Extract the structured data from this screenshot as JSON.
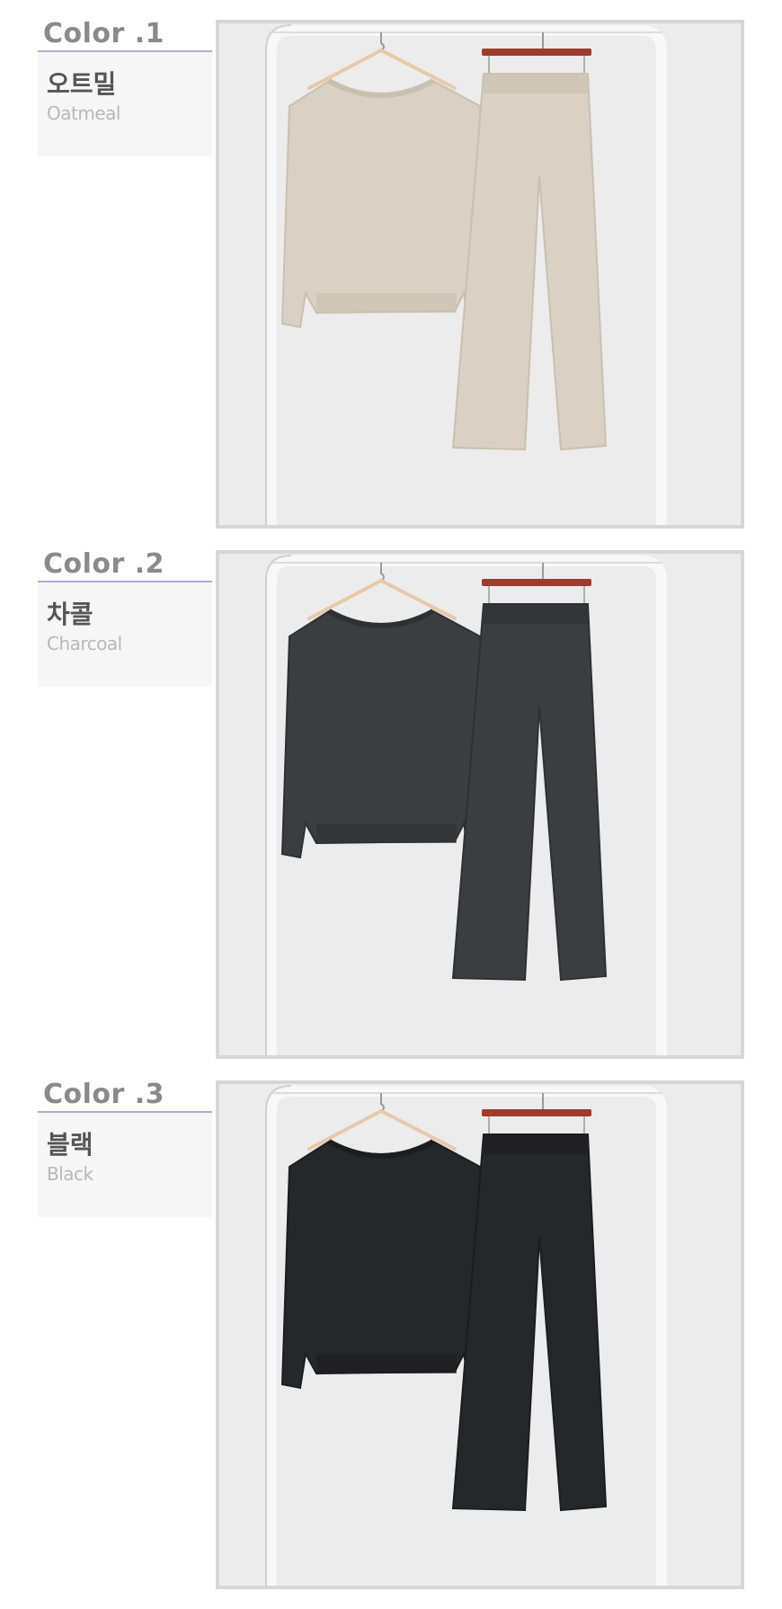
{
  "colors": [
    {
      "heading": "Color .1",
      "name_ko": "오트밀",
      "name_en": "Oatmeal",
      "garment_color": "#d9d1c3",
      "garment_shade": "#c9c0b0"
    },
    {
      "heading": "Color .2",
      "name_ko": "차콜",
      "name_en": "Charcoal",
      "garment_color": "#3c3d41",
      "garment_shade": "#2f3034"
    },
    {
      "heading": "Color .3",
      "name_ko": "블랙",
      "name_en": "Black",
      "garment_color": "#26272b",
      "garment_shade": "#1c1d20"
    }
  ],
  "accent": {
    "underline": "#b5a9da",
    "label_box": "#f6f6f6",
    "frame": "#d6d6d6",
    "hanger_wood": "#e8c9a8",
    "pants_hanger": "#9e3b2c"
  }
}
